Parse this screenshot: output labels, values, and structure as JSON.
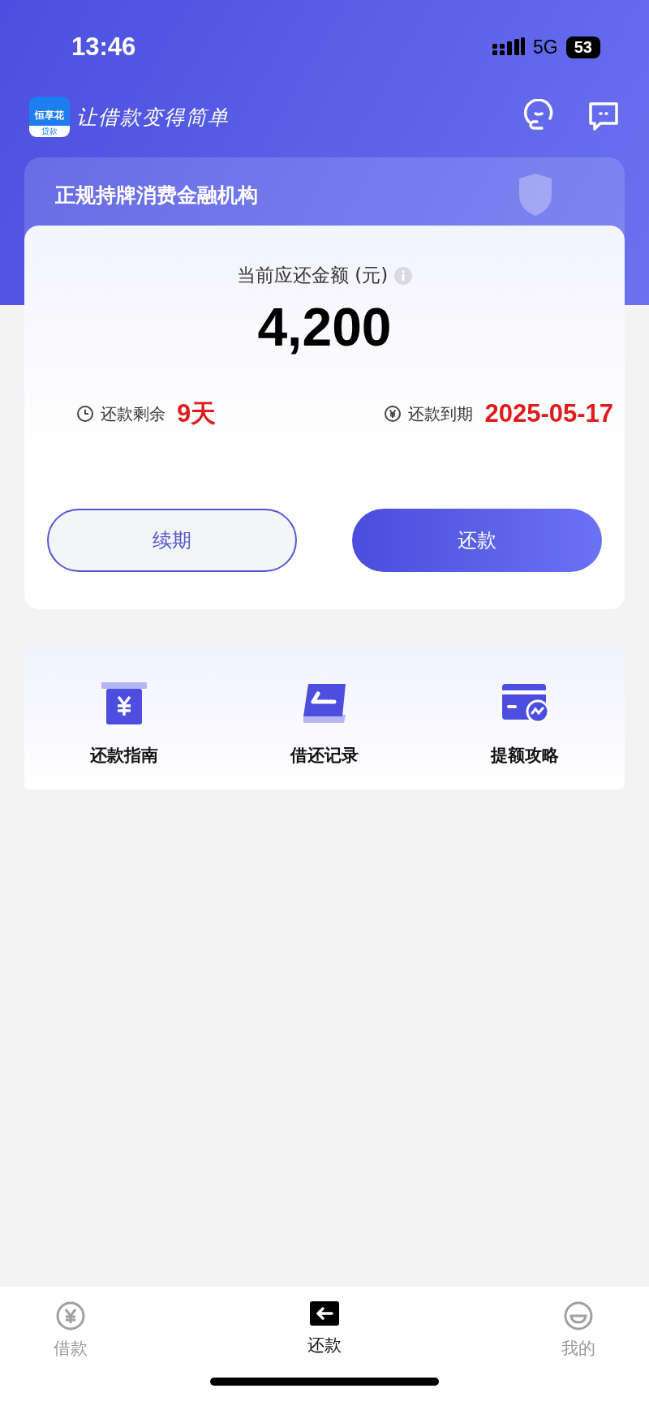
{
  "status_bar": {
    "time": "13:46",
    "network": "5G",
    "battery": "53"
  },
  "header": {
    "logo_name": "恒享花",
    "logo_sub": "贷款",
    "slogan": "让借款变得简单"
  },
  "banner": {
    "title": "正规持牌消费金融机构"
  },
  "repayment": {
    "label": "当前应还金额 (元)",
    "amount": "4,200",
    "remaining_label": "还款剩余",
    "remaining_value": "9天",
    "due_label": "还款到期",
    "due_value": "2025-05-17"
  },
  "buttons": [
    {
      "label": "续期",
      "kind": "outline"
    },
    {
      "label": "还款",
      "kind": "primary"
    }
  ],
  "shortcuts": [
    {
      "label": "还款指南",
      "kind": "guide"
    },
    {
      "label": "借还记录",
      "kind": "records"
    },
    {
      "label": "提额攻略",
      "kind": "limit"
    }
  ],
  "tabs": [
    {
      "label": "借款",
      "kind": "borrow",
      "selected": false
    },
    {
      "label": "还款",
      "kind": "repay",
      "selected": true
    },
    {
      "label": "我的",
      "kind": "mine",
      "selected": false
    }
  ]
}
